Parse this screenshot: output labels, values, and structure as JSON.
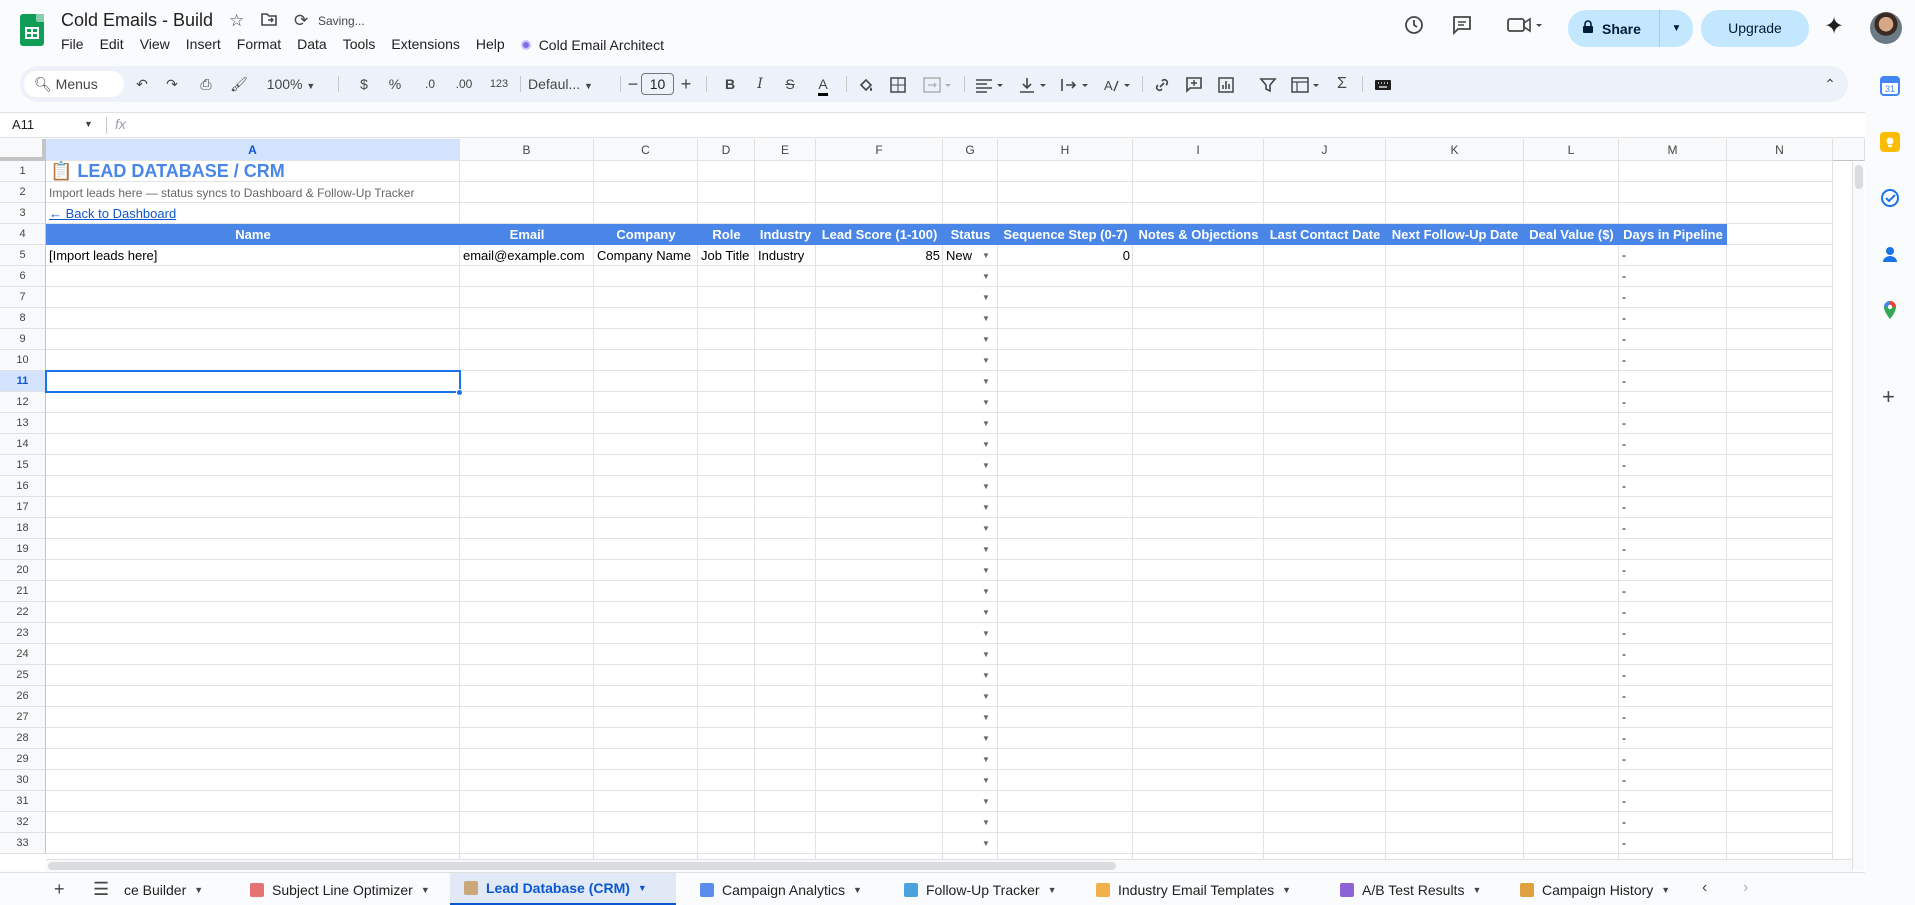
{
  "app": {
    "doc_title": "Cold Emails - Build",
    "saving_status": "Saving...",
    "menu": [
      "File",
      "Edit",
      "View",
      "Insert",
      "Format",
      "Data",
      "Tools",
      "Extensions",
      "Help"
    ],
    "addon_menu": "Cold Email Architect",
    "share_label": "Share",
    "upgrade_label": "Upgrade"
  },
  "toolbar": {
    "menus_label": "Menus",
    "zoom": "100%",
    "currency": "$",
    "percent": "%",
    "dec_decrease": ".0",
    "dec_increase": ".00",
    "number_format": "123",
    "font_family": "Defaul...",
    "font_size": "10"
  },
  "formula_bar": {
    "name_box": "A11",
    "fx": "fx",
    "value": ""
  },
  "columns": [
    "A",
    "B",
    "C",
    "D",
    "E",
    "F",
    "G",
    "H",
    "I",
    "J",
    "K",
    "L",
    "M",
    "N"
  ],
  "rows": [
    "1",
    "2",
    "3",
    "4",
    "5",
    "6",
    "7",
    "8",
    "9",
    "10",
    "11",
    "12",
    "13",
    "14",
    "15",
    "16",
    "17",
    "18",
    "19",
    "20",
    "21",
    "22",
    "23",
    "24",
    "25",
    "26",
    "27",
    "28",
    "29",
    "30",
    "31",
    "32",
    "33"
  ],
  "sheet": {
    "title": "📋 LEAD DATABASE / CRM",
    "subtitle": "Import leads here — status syncs to Dashboard & Follow-Up Tracker",
    "back_link": "← Back to Dashboard",
    "headers": [
      "Name",
      "Email",
      "Company",
      "Role",
      "Industry",
      "Lead Score (1-100)",
      "Status",
      "Sequence Step (0-7)",
      "Notes & Objections",
      "Last Contact Date",
      "Next Follow-Up Date",
      "Deal Value ($)",
      "Days in Pipeline"
    ],
    "row5": {
      "name": "[Import leads here]",
      "email": "email@example.com",
      "company": "Company Name",
      "role": "Job Title",
      "industry": "Industry",
      "lead_score": "85",
      "status": "New",
      "sequence_step": "0",
      "days_in_pipeline": "-"
    },
    "days_placeholder": "-"
  },
  "tabs": [
    {
      "label": "ce Builder",
      "active": false,
      "color": "#e8a23a"
    },
    {
      "label": "Subject Line Optimizer",
      "active": false,
      "color": "#e57373"
    },
    {
      "label": "Lead Database (CRM)",
      "active": true,
      "color": "#c9a77a"
    },
    {
      "label": "Campaign Analytics",
      "active": false,
      "color": "#5b8def"
    },
    {
      "label": "Follow-Up Tracker",
      "active": false,
      "color": "#4aa3df"
    },
    {
      "label": "Industry Email Templates",
      "active": false,
      "color": "#f2b04a"
    },
    {
      "label": "A/B Test Results",
      "active": false,
      "color": "#8e63d6"
    },
    {
      "label": "Campaign History",
      "active": false,
      "color": "#e0a040"
    }
  ]
}
